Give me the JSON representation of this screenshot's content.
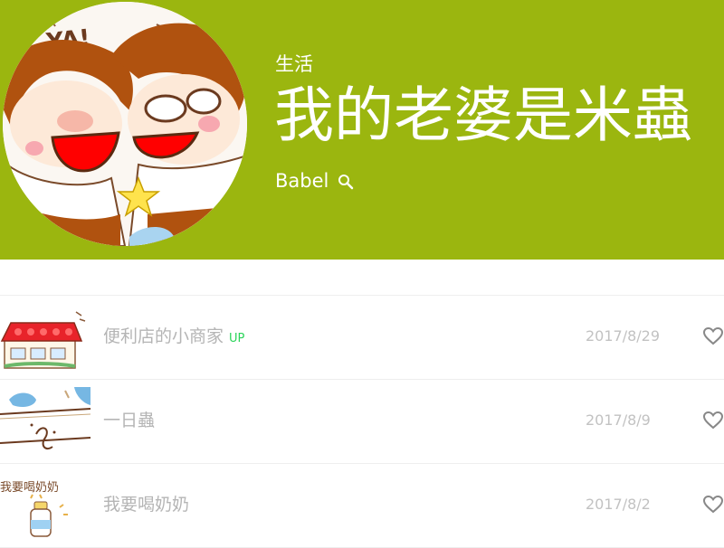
{
  "header": {
    "genre": "生活",
    "title": "我的老婆是米蟲",
    "author": "Babel",
    "background_color": "#9bb60f",
    "avatar_text": "YA!"
  },
  "episodes": [
    {
      "title": "便利店的小商家",
      "badge": "UP",
      "date": "2017/8/29",
      "thumb_text": ""
    },
    {
      "title": "一日蟲",
      "badge": "",
      "date": "2017/8/9",
      "thumb_text": ""
    },
    {
      "title": "我要喝奶奶",
      "badge": "",
      "date": "2017/8/2",
      "thumb_text": "我要喝奶奶"
    }
  ],
  "icons": {
    "search": "search-icon",
    "like": "heart-icon"
  }
}
